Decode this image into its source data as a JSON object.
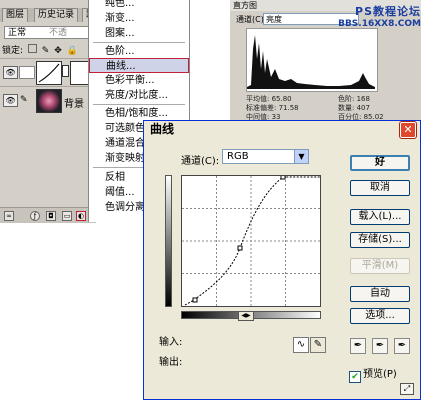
{
  "layers_panel": {
    "tabs": [
      "图层",
      "历史记录",
      "路"
    ],
    "blend_mode": "正常",
    "opacity_label": "不透",
    "lock_label": "锁定:",
    "fill_label": "填",
    "layers": [
      {
        "name": ""
      },
      {
        "name": "背景"
      }
    ]
  },
  "image_menu": {
    "items": [
      "纯色...",
      "渐变...",
      "图案...",
      "色阶...",
      "曲线...",
      "色彩平衡...",
      "亮度/对比度...",
      "色相/饱和度...",
      "可选颜色...",
      "通道混合器...",
      "渐变映射...",
      "反相",
      "阈值...",
      "色调分离..."
    ],
    "highlighted_index": 4
  },
  "histogram_panel": {
    "title": "直方图",
    "channel_label": "通道(C):",
    "channel_value": "亮度",
    "stats": {
      "mean": "平均值: 65.80",
      "std_dev": "标准偏差: 71.58",
      "median": "中间值: 33",
      "level": "色阶: 168",
      "count": "数量: 407",
      "percentile": "百分位: 85.02"
    }
  },
  "watermark": {
    "line1": "PS教程论坛",
    "line2": "BBS.16XX8.COM"
  },
  "curves_dialog": {
    "title": "曲线",
    "channel_label": "通道(C):",
    "channel_value": "RGB",
    "buttons": {
      "ok": "好",
      "cancel": "取消",
      "load": "载入(L)...",
      "save": "存储(S)...",
      "smooth": "平滑(M)",
      "auto": "自动",
      "options": "选项..."
    },
    "input_label": "输入:",
    "output_label": "输出:",
    "preview_label": "预览(P)",
    "preview_checked": true
  }
}
